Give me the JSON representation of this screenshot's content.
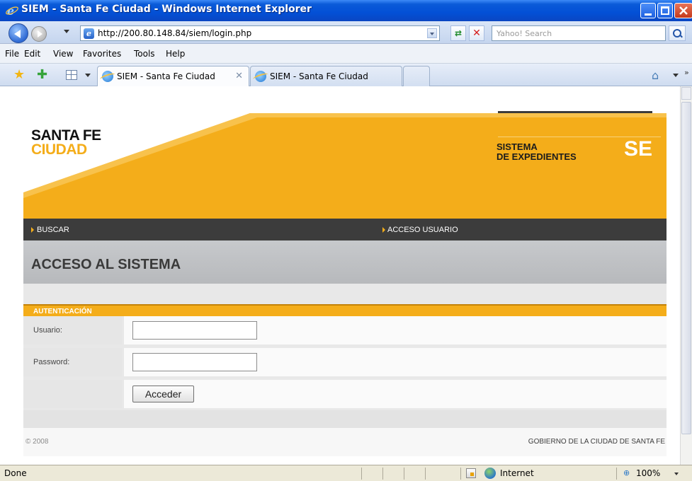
{
  "window": {
    "title": "SIEM - Santa Fe Ciudad - Windows Internet Explorer"
  },
  "address_bar": {
    "url": "http://200.80.148.84/siem/login.php",
    "search_placeholder": "Yahoo! Search"
  },
  "menu": {
    "items": [
      "File",
      "Edit",
      "View",
      "Favorites",
      "Tools",
      "Help"
    ]
  },
  "tabs": [
    {
      "label": "SIEM - Santa Fe Ciudad",
      "active": true
    },
    {
      "label": "SIEM - Santa Fe Ciudad",
      "active": false
    }
  ],
  "page": {
    "brand_line1": "SANTA FE",
    "brand_line2": "CIUDAD",
    "system_title_line1": "SISTEMA",
    "system_title_line2": "DE EXPEDIENTES",
    "system_abbr": "SE",
    "nav": {
      "search": "BUSCAR",
      "user_access": "ACCESO USUARIO"
    },
    "heading": "ACCESO AL SISTEMA",
    "auth_section_label": "AUTENTICACIÓN",
    "form": {
      "username_label": "Usuario:",
      "username_value": "",
      "password_label": "Password:",
      "password_value": "",
      "submit_label": "Acceder"
    },
    "footer": {
      "copyright": "© 2008",
      "government": "GOBIERNO DE LA CIUDAD DE SANTA FE"
    }
  },
  "status_bar": {
    "status": "Done",
    "zone": "Internet",
    "zoom": "100%"
  },
  "colors": {
    "accent_orange": "#f4ad1a",
    "nav_dark": "#3c3c3c",
    "titlebar_blue": "#0350d6"
  }
}
